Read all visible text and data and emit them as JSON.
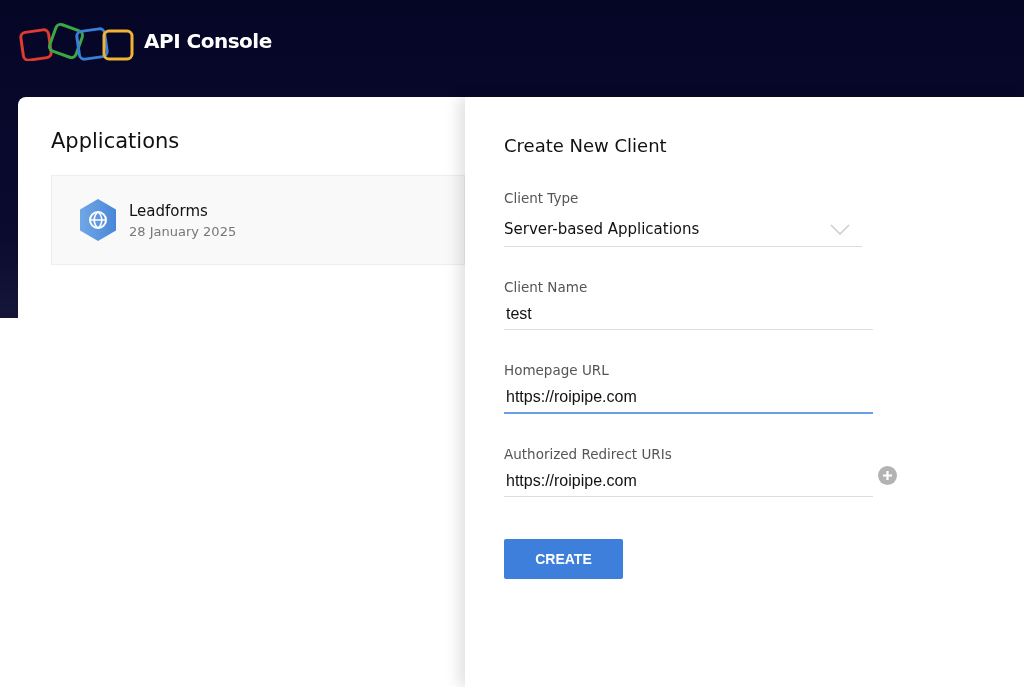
{
  "header": {
    "title": "API Console"
  },
  "applications": {
    "title": "Applications",
    "items": [
      {
        "name": "Leadforms",
        "date": "28 January 2025"
      }
    ]
  },
  "form": {
    "title": "Create New Client",
    "fields": [
      {
        "kind": "select",
        "label": "Client Type",
        "value": "Server-based Applications",
        "focused": false
      },
      {
        "kind": "text",
        "label": "Client Name",
        "value": "test",
        "focused": false
      },
      {
        "kind": "text",
        "label": "Homepage URL",
        "value": "https://roipipe.com",
        "focused": true
      },
      {
        "kind": "uri",
        "label": "Authorized Redirect URIs",
        "value": "https://roipipe.com",
        "focused": false
      }
    ],
    "submit": "CREATE"
  }
}
